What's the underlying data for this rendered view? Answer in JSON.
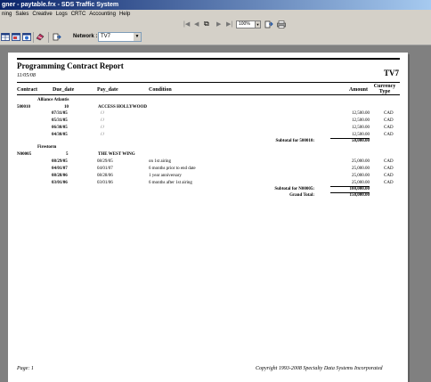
{
  "window": {
    "title": "gner - paytable.frx - SDS Traffic System"
  },
  "menu": [
    "ning",
    "Sales",
    "Creative",
    "Logs",
    "CRTC",
    "Accounting",
    "Help"
  ],
  "toolbar": {
    "zoom": "100%",
    "network_label": "Network :",
    "network_value": "TV7"
  },
  "report": {
    "title": "Programming Contract Report",
    "date": "11/05/08",
    "network": "TV7",
    "columns": {
      "contract": "Contract",
      "due_date": "Due_date",
      "pay_date": "Pay_date",
      "condition": "Condition",
      "amount": "Amount",
      "currency": "Currency",
      "currency2": "Type"
    },
    "groups": [
      {
        "distributor": "Alliance Atlantis",
        "contract": "500010",
        "count": "10",
        "program": "ACCESS HOLLYWOOD",
        "rows": [
          {
            "due": "07/31/05",
            "pay": "/ /",
            "cond": "",
            "amount": "12,500.00",
            "cur": "CAD"
          },
          {
            "due": "05/31/05",
            "pay": "/ /",
            "cond": "",
            "amount": "12,500.00",
            "cur": "CAD"
          },
          {
            "due": "06/30/05",
            "pay": "/ /",
            "cond": "",
            "amount": "12,500.00",
            "cur": "CAD"
          },
          {
            "due": "04/30/05",
            "pay": "/ /",
            "cond": "",
            "amount": "12,500.00",
            "cur": "CAD"
          }
        ],
        "subtotal_label": "Subtotal for 500010:",
        "subtotal": "50,000.00"
      },
      {
        "distributor": "Firestorm",
        "contract": "N00005",
        "count": "5",
        "program": "THE WEST WING",
        "rows": [
          {
            "due": "08/29/05",
            "pay": "08/29/05",
            "cond": "on 1st airing",
            "amount": "25,000.00",
            "cur": "CAD"
          },
          {
            "due": "04/01/07",
            "pay": "04/01/07",
            "cond": "6 months prior to end date",
            "amount": "25,000.00",
            "cur": "CAD"
          },
          {
            "due": "08/28/06",
            "pay": "08/28/06",
            "cond": "1 year anniversary",
            "amount": "25,000.00",
            "cur": "CAD"
          },
          {
            "due": "03/01/06",
            "pay": "03/01/06",
            "cond": "6 months after 1st airing",
            "amount": "25,000.00",
            "cur": "CAD"
          }
        ],
        "subtotal_label": "Subtotal for N00005:",
        "subtotal": "100,000.00"
      }
    ],
    "grand_total_label": "Grand Total:",
    "grand_total": "150,000.00",
    "footer_page": "Page: 1",
    "footer_copyright": "Copyright 1993-2008 Specialty Data Systems Incorporated"
  }
}
